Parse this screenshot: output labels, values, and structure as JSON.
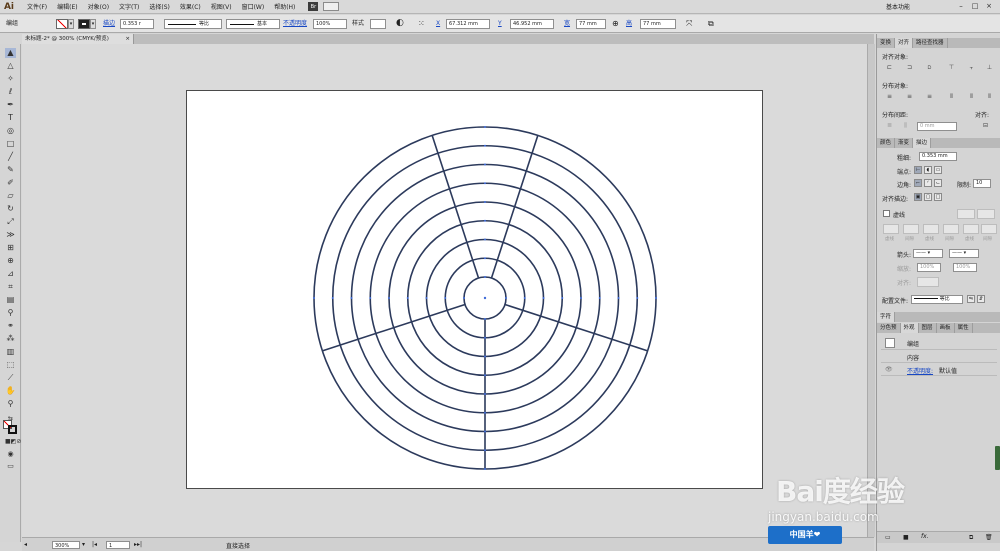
{
  "app": {
    "logo": "Ai",
    "workspace": "基本功能",
    "window_controls": [
      "–",
      "□",
      "×"
    ]
  },
  "menu": [
    "文件(F)",
    "编辑(E)",
    "对象(O)",
    "文字(T)",
    "选择(S)",
    "效果(C)",
    "视图(V)",
    "窗口(W)",
    "帮助(H)"
  ],
  "menu_extra": {
    "bridge": "Br"
  },
  "control_bar": {
    "selection_label": "编组",
    "stroke_label": "描边",
    "stroke_value": "0.353 r",
    "profile_label": "等比",
    "brush_label": "基本",
    "opacity_label": "不透明度",
    "opacity_value": "100%",
    "style_label": "样式",
    "x_label": "X",
    "x_value": "67.312 mm",
    "y_label": "Y",
    "y_value": "46.952 mm",
    "w_label": "宽",
    "w_value": "77 mm",
    "h_label": "高",
    "h_value": "77 mm"
  },
  "document": {
    "tab_title": "未标题-2* @ 300% (CMYK/预览)",
    "close_icon": "×"
  },
  "status": {
    "zoom": "300%",
    "page": "1",
    "tool_hint": "直接选择"
  },
  "toolbar_icons": [
    "selection-tool",
    "direct-selection-tool",
    "magic-wand-tool",
    "lasso-tool",
    "pen-tool",
    "type-tool",
    "line-tool",
    "rectangle-tool",
    "paintbrush-tool",
    "pencil-tool",
    "blob-brush-tool",
    "eraser-tool",
    "rotate-tool",
    "scale-tool",
    "width-tool",
    "free-transform-tool",
    "shape-builder-tool",
    "perspective-grid-tool",
    "mesh-tool",
    "gradient-tool",
    "eyedropper-tool",
    "blend-tool",
    "symbol-sprayer-tool",
    "column-graph-tool",
    "artboard-tool",
    "slice-tool",
    "hand-tool",
    "zoom-tool"
  ],
  "align_panel": {
    "tabs": [
      "变换",
      "对齐",
      "路径查找器"
    ],
    "align_objects_label": "对齐对象:",
    "distribute_objects_label": "分布对象:",
    "distribute_spacing_label": "分布间距:",
    "align_to_label": "对齐:",
    "spacing_value": "0 mm"
  },
  "stroke_panel": {
    "tabs": [
      "颜色",
      "渐变",
      "描边"
    ],
    "weight_label": "粗细:",
    "weight_value": "0.353 mm",
    "cap_label": "端点:",
    "corner_label": "边角:",
    "limit_label": "限制:",
    "limit_value": "10",
    "align_label": "对齐描边:",
    "dashed_label": "虚线",
    "dash_labels": [
      "虚线",
      "间隙",
      "虚线",
      "间隙",
      "虚线",
      "间隙"
    ],
    "arrows_label": "箭头:",
    "scale_label": "缩放:",
    "scale_values": [
      "100%",
      "100%"
    ],
    "align_arrow_label": "对齐:",
    "profile_label": "配置文件:",
    "profile_value": "等比"
  },
  "char_panel": {
    "tabs": [
      "字符"
    ]
  },
  "appearance_panel": {
    "tabs": [
      "分色预",
      "外观",
      "图层",
      "画板",
      "属性"
    ],
    "group_label": "编组",
    "contents_label": "内容",
    "opacity_label": "不透明度:",
    "opacity_value": "默认值",
    "footer_icons": [
      "new-item-icon",
      "fx-icon",
      "delete-icon"
    ]
  },
  "watermark": {
    "brand": "Bai度经验",
    "url": "jingyan.baidu.com",
    "badge": "中国羊❤"
  },
  "colors": {
    "stroke": "#2c3a5c",
    "anchor": "#3f6bd8",
    "artboard": "#ffffff",
    "canvas": "#dadada",
    "ui": "#d4d4d4"
  },
  "artwork": {
    "type": "concentric rings with radial spokes",
    "ring_count": 9,
    "spoke_count": 5
  }
}
